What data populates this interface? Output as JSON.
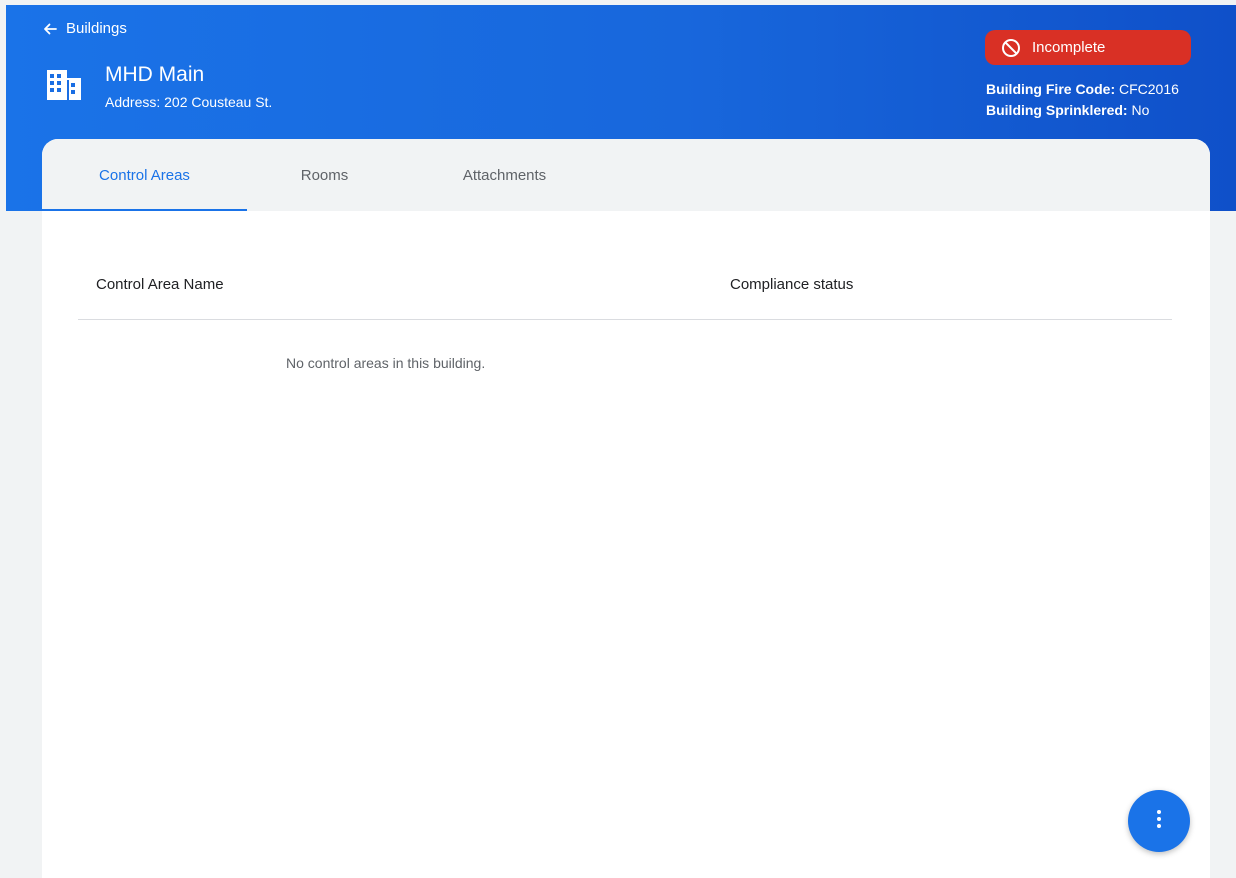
{
  "header": {
    "back_label": "Buildings",
    "building_name": "MHD Main",
    "address": "Address: 202 Cousteau St.",
    "status_label": "Incomplete",
    "fire_code_label": "Building Fire Code:",
    "fire_code_value": "CFC2016",
    "sprinklered_label": "Building Sprinklered:",
    "sprinklered_value": "No"
  },
  "tabs": [
    {
      "label": "Control Areas",
      "active": true
    },
    {
      "label": "Rooms",
      "active": false
    },
    {
      "label": "Attachments",
      "active": false
    }
  ],
  "table": {
    "columns": [
      "Control Area Name",
      "Compliance status"
    ],
    "rows": [],
    "empty_message": "No control areas in this building."
  },
  "icons": {
    "back": "arrow-left-icon",
    "building": "building-icon",
    "status": "block-icon",
    "fab": "more-vert-icon"
  },
  "colors": {
    "header_start": "#1a73e8",
    "header_end": "#0f50c9",
    "status_bg": "#d93025",
    "accent": "#1a73e8",
    "page_bg": "#f1f3f4"
  }
}
